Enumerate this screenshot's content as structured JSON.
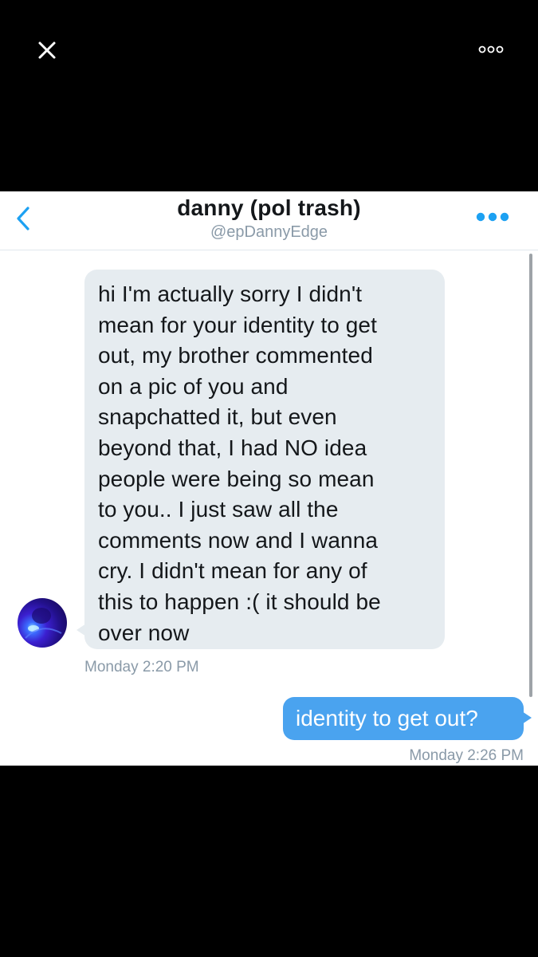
{
  "viewer": {
    "close_icon": "close-icon",
    "more_icon": "more-options-icon"
  },
  "conversation": {
    "title": "danny (pol trash)",
    "handle": "@epDannyEdge",
    "back_icon": "chevron-left-icon",
    "more_icon": "more-dots-icon",
    "accent_color": "#1da1f2"
  },
  "messages": {
    "incoming": {
      "lines": [
        "hi I'm actually sorry I didn't",
        "mean for your identity to get",
        "out, my brother commented",
        "on a pic of you and",
        "snapchatted it, but even",
        "beyond that, I had NO idea",
        "people were being so mean",
        "to you.. I just saw all the",
        "comments now and I wanna",
        "cry. I didn't mean for any of",
        "this to happen :( it should be",
        "over now"
      ],
      "timestamp": "Monday 2:20 PM",
      "bubble_color": "#e6ecf0"
    },
    "outgoing": {
      "text": "identity to get out?",
      "timestamp": "Monday 2:26 PM",
      "bubble_color": "#4aa3ef"
    }
  }
}
